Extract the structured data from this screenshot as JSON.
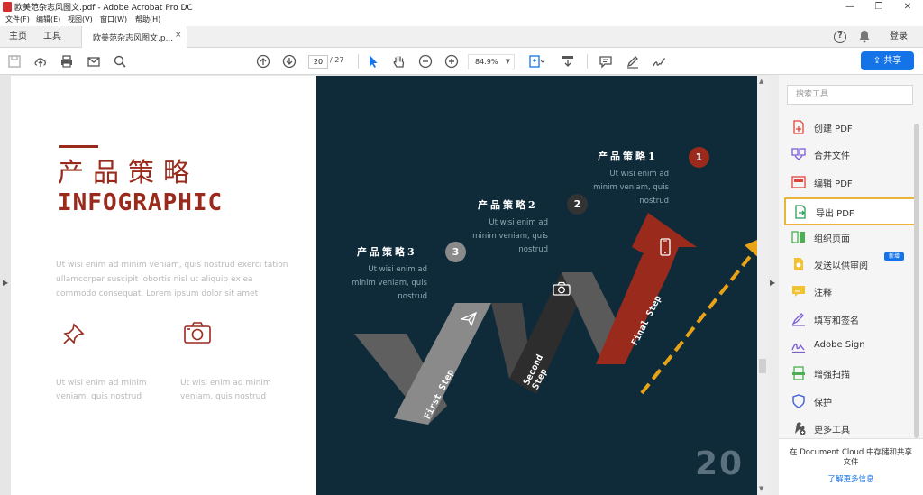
{
  "window": {
    "title": "欧美范杂志风图文.pdf - Adobe Acrobat Pro DC",
    "minimize": "—",
    "restore": "❐",
    "close": "✕"
  },
  "menu": [
    "文件(F)",
    "编辑(E)",
    "视图(V)",
    "窗口(W)",
    "帮助(H)"
  ],
  "tabs": {
    "home": "主页",
    "tools": "工具",
    "document": "欧美范杂志风图文.p...",
    "close": "×",
    "login": "登录"
  },
  "toolbar": {
    "page_current": "20",
    "page_total": "/ 27",
    "zoom": "84.9%",
    "share": "共享"
  },
  "document": {
    "left_page": {
      "title_cn": "产品策略",
      "title_en": "INFOGRAPHIC",
      "paragraph": "Ut wisi enim ad minim veniam, quis nostrud exerci tation ullamcorper suscipit lobortis nisl ut aliquip ex ea commodo consequat. Lorem ipsum dolor sit amet",
      "caption_1": "Ut wisi enim ad minim veniam, quis nostrud",
      "caption_2": "Ut wisi enim ad minim veniam, quis nostrud"
    },
    "right_page": {
      "steps": [
        {
          "num": "1",
          "title": "产品策略1",
          "desc_lines": [
            "Ut wisi enim ad",
            "minim veniam, quis",
            "nostrud"
          ],
          "color": "#9a2a1c"
        },
        {
          "num": "2",
          "title": "产品策略2",
          "desc_lines": [
            "Ut wisi enim ad",
            "minim veniam, quis",
            "nostrud"
          ],
          "color": "#333333"
        },
        {
          "num": "3",
          "title": "产品策略3",
          "desc_lines": [
            "Ut wisi enim ad",
            "minim veniam, quis",
            "nostrud"
          ],
          "color": "#8a8a8a"
        }
      ],
      "ribbon_labels": [
        "First Step",
        "Second Step",
        "Final Step"
      ],
      "page_number": "20"
    }
  },
  "right_panel": {
    "search_placeholder": "搜索工具",
    "tools": [
      {
        "label": "创建 PDF",
        "color": "#e0453a"
      },
      {
        "label": "合并文件",
        "color": "#7b5cd6"
      },
      {
        "label": "编辑 PDF",
        "color": "#e0453a"
      },
      {
        "label": "导出 PDF",
        "color": "#2f9e5a"
      },
      {
        "label": "组织页面",
        "color": "#4caf50"
      },
      {
        "label": "发送以供审阅",
        "color": "#f2c230"
      },
      {
        "label": "注释",
        "color": "#f2c230"
      },
      {
        "label": "填写和签名",
        "color": "#7b5cd6"
      },
      {
        "label": "Adobe Sign",
        "color": "#7b5cd6"
      },
      {
        "label": "增强扫描",
        "color": "#4caf50"
      },
      {
        "label": "保护",
        "color": "#3f5fd9"
      },
      {
        "label": "更多工具",
        "color": "#555555"
      }
    ],
    "new_badge": "新增",
    "footer_text": "在 Document Cloud 中存储和共享文件",
    "footer_link": "了解更多信息"
  },
  "colors": {
    "accent": "#1473e6",
    "brand_red": "#9a2a1c",
    "dark_page": "#0f2b3a",
    "highlight": "#e8b53a"
  }
}
